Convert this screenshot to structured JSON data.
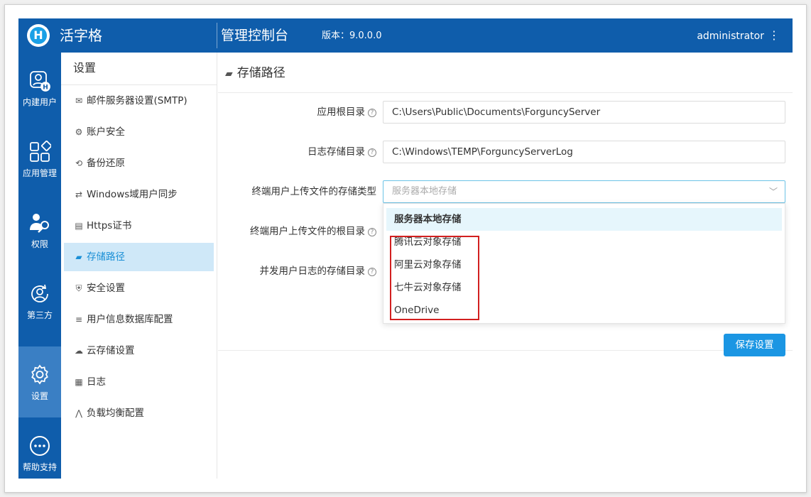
{
  "topbar": {
    "brand": "活字格",
    "logo_letter": "H",
    "console_title": "管理控制台",
    "version": "版本：9.0.0.0",
    "user": "administrator",
    "more": "⋮"
  },
  "leftnav": {
    "items": [
      {
        "label": "内建用户",
        "icon": "builtin-user-icon"
      },
      {
        "label": "应用管理",
        "icon": "app-grid-icon"
      },
      {
        "label": "权限",
        "icon": "permission-user-key-icon"
      },
      {
        "label": "第三方",
        "icon": "third-party-user-icon"
      },
      {
        "label": "设置",
        "icon": "gear-icon"
      },
      {
        "label": "帮助支持",
        "icon": "more-circle-icon"
      }
    ]
  },
  "menu": {
    "title": "设置",
    "items": [
      {
        "label": "邮件服务器设置(SMTP)",
        "icon": "✉"
      },
      {
        "label": "账户安全",
        "icon": "⚙"
      },
      {
        "label": "备份还原",
        "icon": "⟲"
      },
      {
        "label": "Windows域用户同步",
        "icon": "⇄"
      },
      {
        "label": "Https证书",
        "icon": "▤"
      },
      {
        "label": "存储路径",
        "icon": "▰"
      },
      {
        "label": "安全设置",
        "icon": "⛨"
      },
      {
        "label": "用户信息数据库配置",
        "icon": "≡"
      },
      {
        "label": "云存储设置",
        "icon": "☁"
      },
      {
        "label": "日志",
        "icon": "▦"
      },
      {
        "label": "负载均衡配置",
        "icon": "⋀"
      }
    ]
  },
  "content": {
    "title": "存储路径",
    "title_icon": "folder-open-icon",
    "help_glyph": "?",
    "fields": {
      "app_root": {
        "label": "应用根目录",
        "value": "C:\\Users\\Public\\Documents\\ForguncyServer"
      },
      "log_dir": {
        "label": "日志存储目录",
        "value": "C:\\Windows\\TEMP\\ForguncyServerLog"
      },
      "upload_type": {
        "label": "终端用户上传文件的存储类型",
        "placeholder": "服务器本地存储"
      },
      "upload_root": {
        "label": "终端用户上传文件的根目录"
      },
      "concurrent_log": {
        "label": "并发用户日志的存储目录"
      }
    },
    "save_label": "保存设置"
  },
  "dropdown": {
    "options": [
      "服务器本地存储",
      "腾讯云对象存储",
      "阿里云对象存储",
      "七牛云对象存储",
      "OneDrive"
    ]
  },
  "colors": {
    "header": "#0f5dab",
    "nav_active": "#3a7fc4",
    "menu_active_bg": "#cfe8f8",
    "accent": "#1b96e3",
    "highlight_box": "#d21f1f"
  }
}
